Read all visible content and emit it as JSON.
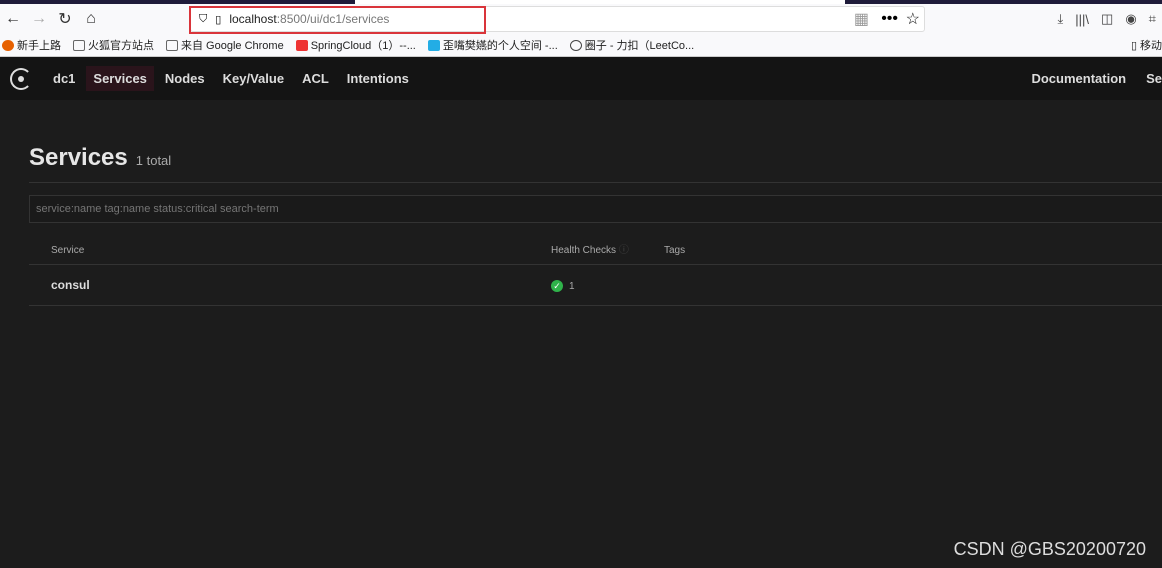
{
  "browser": {
    "url_host": "localhost",
    "url_path": ":8500/ui/dc1/services",
    "bookmarks": [
      "新手上路",
      "火狐官方站点",
      "来自 Google Chrome",
      "SpringCloud（1）--...",
      "歪嘴樊嬿的个人空间 -...",
      "圈子 - 力扣（LeetCo...",
      "移动"
    ]
  },
  "nav": {
    "dc": "dc1",
    "items": [
      "Services",
      "Nodes",
      "Key/Value",
      "ACL",
      "Intentions"
    ],
    "right": [
      "Documentation",
      "Se"
    ]
  },
  "page": {
    "title": "Services",
    "count": "1 total",
    "search_placeholder": "service:name tag:name status:critical search-term"
  },
  "table": {
    "headers": [
      "Service",
      "Health Checks",
      "Tags"
    ],
    "rows": [
      {
        "service": "consul",
        "checks": "1",
        "status": "passing"
      }
    ]
  },
  "watermark": "CSDN @GBS20200720",
  "colors": {
    "accent": "#d9343a",
    "passing": "#2fb34a"
  }
}
